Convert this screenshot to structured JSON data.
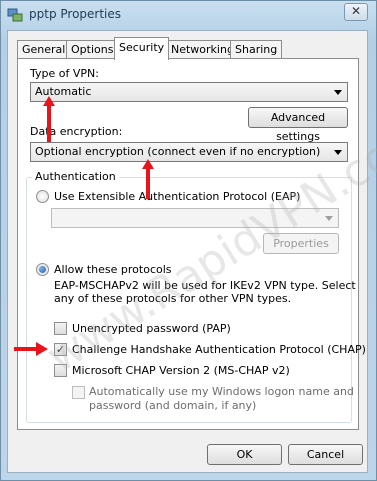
{
  "window": {
    "title": "pptp Properties",
    "close_label": "✕"
  },
  "tabs": [
    {
      "label": "General"
    },
    {
      "label": "Options"
    },
    {
      "label": "Security"
    },
    {
      "label": "Networking"
    },
    {
      "label": "Sharing"
    }
  ],
  "security": {
    "vpn_type_label": "Type of VPN:",
    "vpn_type_value": "Automatic",
    "advanced_settings_label": "Advanced settings",
    "data_encryption_label": "Data encryption:",
    "data_encryption_value": "Optional encryption (connect even if no encryption)",
    "auth_group_title": "Authentication",
    "eap_radio_label": "Use Extensible Authentication Protocol (EAP)",
    "eap_combo_value": "",
    "properties_label": "Properties",
    "allow_protocols_label": "Allow these protocols",
    "eap_note": "EAP-MSCHAPv2 will be used for IKEv2 VPN type. Select any of these protocols for other VPN types.",
    "eap_note_line1": "EAP-MSCHAPv2 will be used for IKEv2 VPN type. Select",
    "eap_note_line2": "any of these protocols for other VPN types.",
    "protocols": [
      {
        "label": "Unencrypted password (PAP)",
        "checked": false
      },
      {
        "label": "Challenge Handshake Authentication Protocol (CHAP)",
        "checked": true
      },
      {
        "label": "Microsoft CHAP Version 2 (MS-CHAP v2)",
        "checked": false
      }
    ],
    "auto_logon_line1": "Automatically use my Windows logon name and",
    "auto_logon_line2": "password (and domain, if any)"
  },
  "footer": {
    "ok_label": "OK",
    "cancel_label": "Cancel"
  },
  "watermark": "www.RapidVPN.com",
  "colors": {
    "annotation_arrow": "#e8141b",
    "radio_selected": "#1c5fb4"
  }
}
